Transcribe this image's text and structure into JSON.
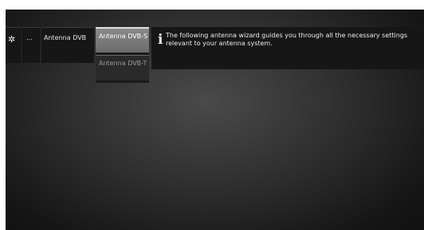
{
  "breadcrumb": {
    "gear_icon": "gear-icon",
    "ellipsis": "...",
    "current": "Antenna DVB"
  },
  "submenu": {
    "items": [
      {
        "label": "Antenna DVB-S",
        "selected": true
      },
      {
        "label": "Antenna DVB-T",
        "selected": false
      }
    ]
  },
  "info": {
    "icon": "info-icon",
    "text": "The following antenna wizard guides you through all the necessary settings relevant to your antenna system."
  }
}
